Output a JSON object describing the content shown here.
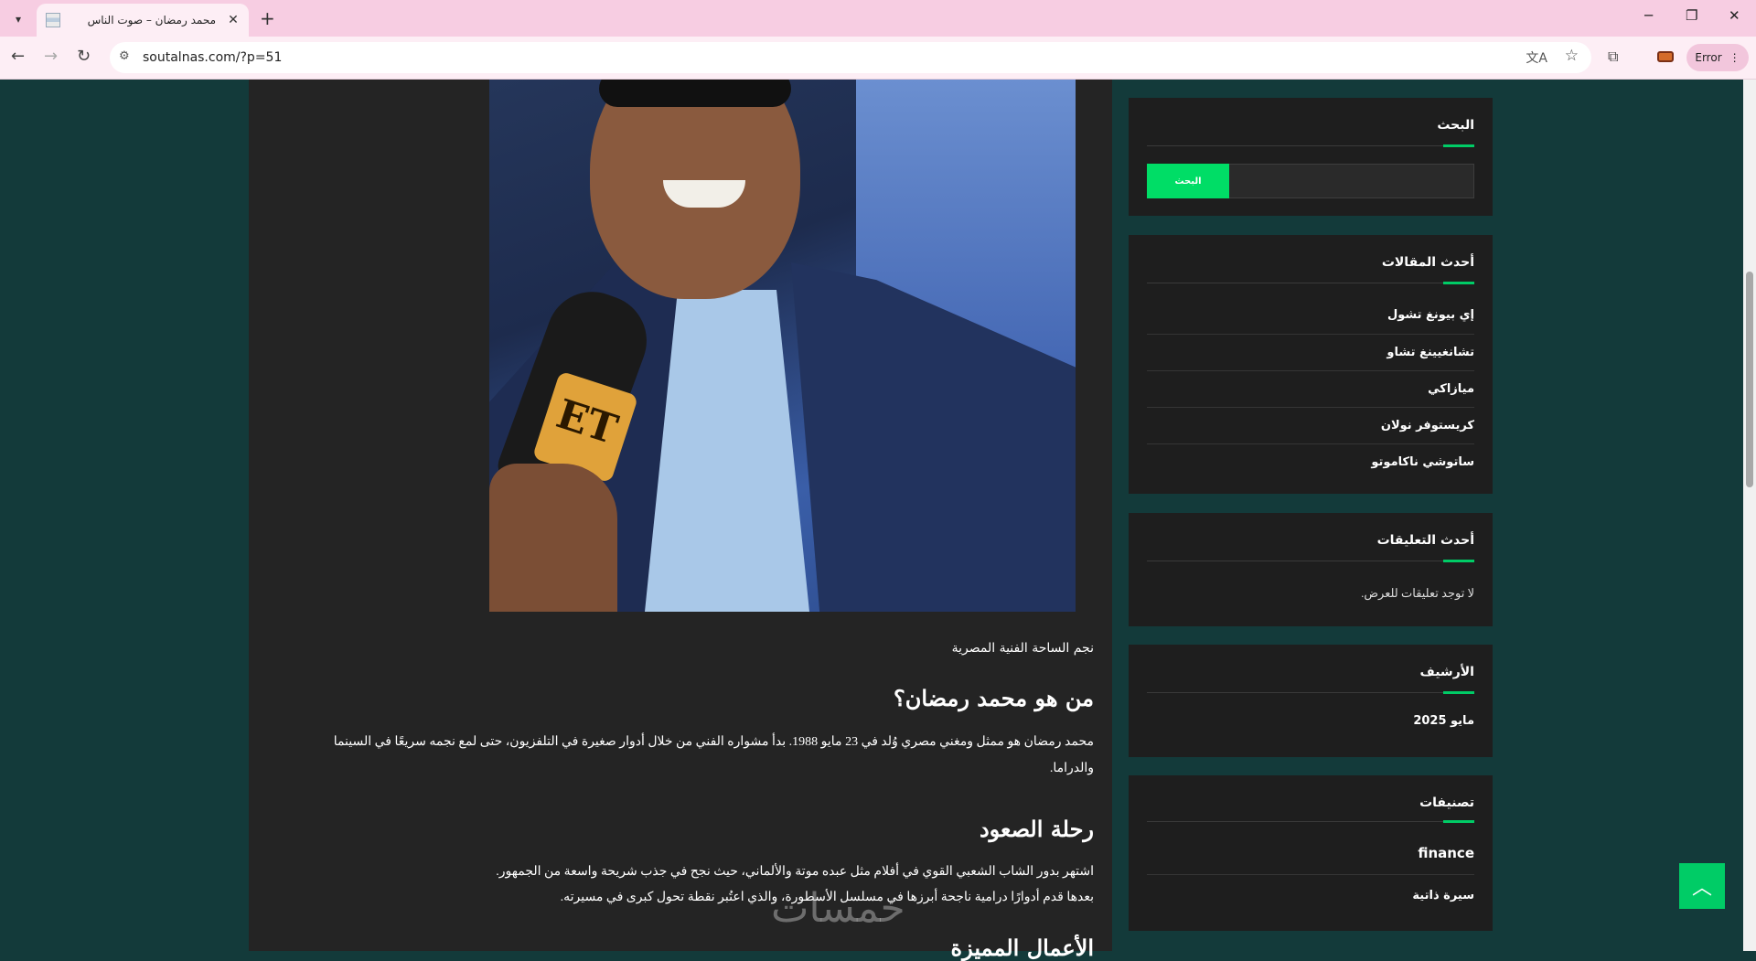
{
  "browser": {
    "tab_title": "محمد رمضان – صوت الناس",
    "url": "soutalnas.com/?p=51",
    "error_label": "Error",
    "new_tab_glyph": "+",
    "tab_close_glyph": "✕",
    "minimize_glyph": "─",
    "restore_glyph": "❐",
    "close_glyph": "✕"
  },
  "article": {
    "image_caption": "نجم الساحة الفنية المصرية",
    "section1_heading": "من هو محمد رمضان؟",
    "section1_text": "محمد رمضان هو ممثل ومغني مصري وُلد في 23 مايو 1988. بدأ مشواره الفني من خلال أدوار صغيرة في التلفزيون، حتى لمع نجمه سريعًا في السينما والدراما.",
    "section2_heading": "رحلة الصعود",
    "section2_line1": "اشتهر بدور الشاب الشعبي القوي في أفلام مثل عبده موتة والألماني، حيث نجح في جذب شريحة واسعة من الجمهور.",
    "section2_line2": "بعدها قدم أدوارًا درامية ناجحة أبرزها في مسلسل الأسطورة، والذي اعتُبر نقطة تحول كبرى في مسيرته.",
    "partial_heading": "الأعمال المميزة"
  },
  "sidebar": {
    "search": {
      "title": "البحث",
      "button_label": "البحث",
      "placeholder": ""
    },
    "recent_posts": {
      "title": "أحدث المقالات",
      "items": [
        "إي بيونغ تشول",
        "تشانغيينغ تشاو",
        "ميازاكي",
        "كريستوفر نولان",
        "ساتوشي ناكاموتو"
      ]
    },
    "recent_comments": {
      "title": "أحدث التعليقات",
      "empty_text": "لا توجد تعليقات للعرض."
    },
    "archives": {
      "title": "الأرشيف",
      "items": [
        "مايو 2025"
      ]
    },
    "categories": {
      "title": "تصنيفات",
      "items": [
        "finance",
        "سيرة ذاتية"
      ]
    }
  },
  "watermark": "خمسات",
  "colors": {
    "accent": "#00cc66",
    "page_bg": "#133a3a",
    "card_bg": "#1e1e1e",
    "content_bg": "#242424"
  }
}
